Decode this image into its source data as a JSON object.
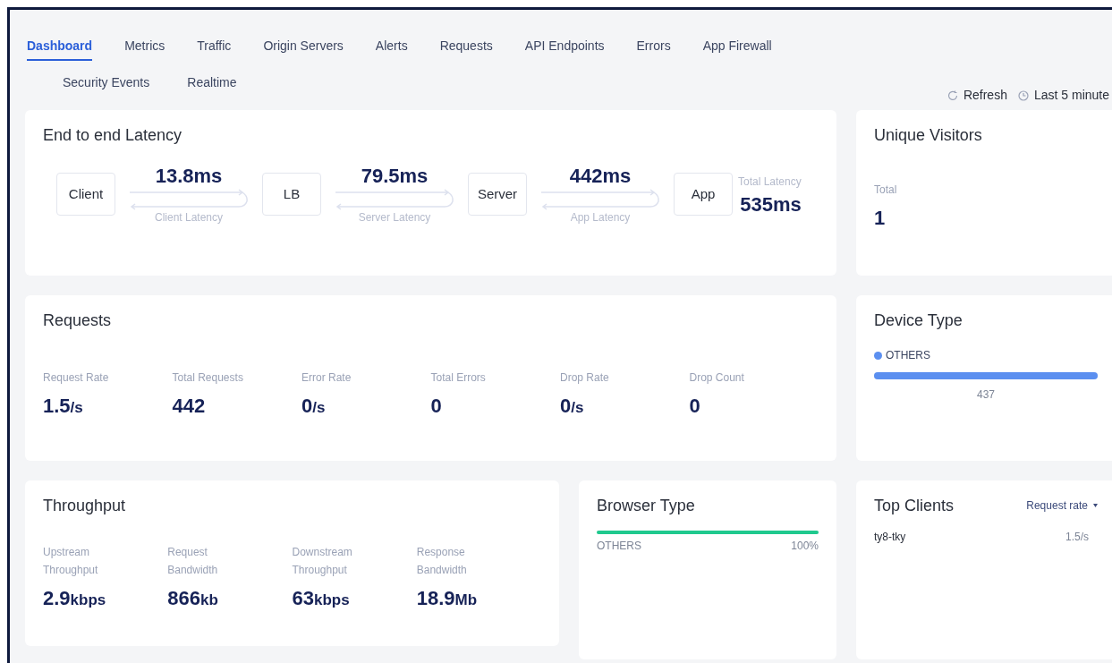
{
  "tabs": [
    {
      "label": "Dashboard",
      "selected": true
    },
    {
      "label": "Metrics",
      "selected": false
    },
    {
      "label": "Traffic",
      "selected": false
    },
    {
      "label": "Origin Servers",
      "selected": false
    },
    {
      "label": "Alerts",
      "selected": false
    },
    {
      "label": "Requests",
      "selected": false
    },
    {
      "label": "API Endpoints",
      "selected": false
    },
    {
      "label": "Errors",
      "selected": false
    },
    {
      "label": "App Firewall",
      "selected": false
    },
    {
      "label": "Security Events",
      "selected": false
    },
    {
      "label": "Realtime",
      "selected": false
    }
  ],
  "toolbar": {
    "refresh": "Refresh",
    "time_range": "Last 5 minute"
  },
  "latency": {
    "title": "End to end Latency",
    "nodes": [
      "Client",
      "LB",
      "Server",
      "App"
    ],
    "segments": [
      {
        "value": "13.8ms",
        "label": "Client Latency"
      },
      {
        "value": "79.5ms",
        "label": "Server Latency"
      },
      {
        "value": "442ms",
        "label": "App Latency"
      }
    ],
    "total_label": "Total Latency",
    "total_value": "535ms"
  },
  "unique_visitors": {
    "title": "Unique Visitors",
    "label": "Total",
    "value": "1"
  },
  "requests": {
    "title": "Requests",
    "metrics": [
      {
        "label": "Request Rate",
        "value": "1.5",
        "unit": "/s"
      },
      {
        "label": "Total Requests",
        "value": "442"
      },
      {
        "label": "Error Rate",
        "value": "0",
        "unit": "/s"
      },
      {
        "label": "Total Errors",
        "value": "0"
      },
      {
        "label": "Drop Rate",
        "value": "0",
        "unit": "/s"
      },
      {
        "label": "Drop Count",
        "value": "0"
      }
    ]
  },
  "device_type": {
    "title": "Device Type",
    "items": [
      {
        "name": "OTHERS",
        "color": "#5b8ff0",
        "level": 1,
        "count": "437"
      }
    ]
  },
  "throughput": {
    "title": "Throughput",
    "metrics": [
      {
        "label": "Upstream Throughput",
        "value": "2.9",
        "unit": "kbps"
      },
      {
        "label": "Request Bandwidth",
        "value": "866",
        "unit": "kb"
      },
      {
        "label": "Downstream Throughput",
        "value": "63",
        "unit": "kbps"
      },
      {
        "label": "Response Bandwidth",
        "value": "18.9",
        "unit": "Mb"
      }
    ]
  },
  "browser_type": {
    "title": "Browser Type",
    "items": [
      {
        "name": "OTHERS",
        "color": "#1fc98e",
        "level": 1,
        "percent": "100%"
      }
    ]
  },
  "top_clients": {
    "title": "Top Clients",
    "sort": "Request rate",
    "rows": [
      {
        "name": "ty8-tky",
        "value": "1.5/s"
      }
    ]
  }
}
